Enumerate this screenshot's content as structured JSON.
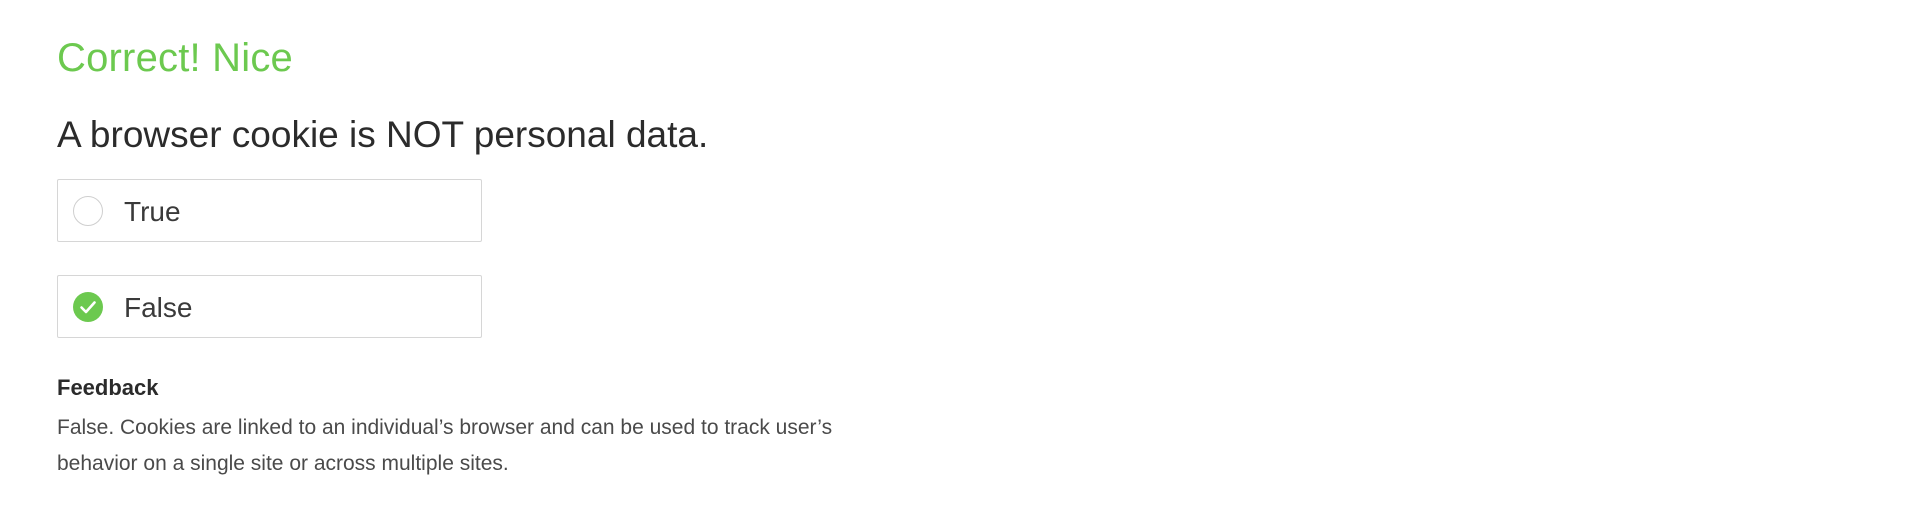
{
  "result": {
    "heading": "Correct! Nice",
    "color": "#6cc94f"
  },
  "question": {
    "text": "A browser cookie is NOT personal data."
  },
  "options": [
    {
      "label": "True",
      "selected": false
    },
    {
      "label": "False",
      "selected": true
    }
  ],
  "icons": {
    "unselected": "radio-empty-icon",
    "selected": "check-circle-icon"
  },
  "feedback": {
    "title": "Feedback",
    "text": "False. Cookies are linked to an individual’s browser and can be used to track user’s behavior on a single site or across multiple sites."
  }
}
